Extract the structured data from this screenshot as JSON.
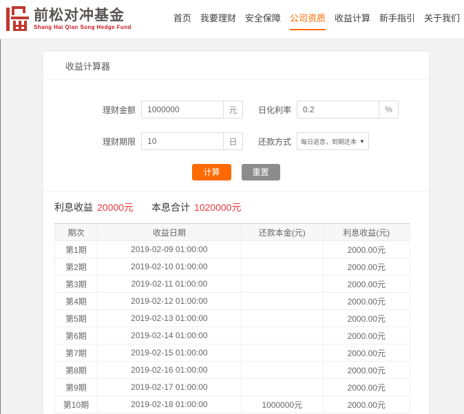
{
  "brand": {
    "title": "前松对冲基金",
    "subtitle": "Shang Hai Qian Song Hedge Fund"
  },
  "nav": {
    "items": [
      {
        "label": "首页",
        "active": false
      },
      {
        "label": "我要理财",
        "active": false
      },
      {
        "label": "安全保障",
        "active": false
      },
      {
        "label": "公司资质",
        "active": true
      },
      {
        "label": "收益计算",
        "active": false
      },
      {
        "label": "新手指引",
        "active": false
      },
      {
        "label": "关于我们",
        "active": false
      }
    ]
  },
  "calculator": {
    "title": "收益计算器",
    "amount_label": "理财金额",
    "amount_value": "1000000",
    "amount_unit": "元",
    "rate_label": "日化利率",
    "rate_value": "0.2",
    "rate_unit": "%",
    "period_label": "理财期限",
    "period_value": "10",
    "period_unit": "日",
    "repay_label": "还款方式",
    "repay_value": "每日返息，到期还本",
    "calc_button": "计算",
    "reset_button": "重置"
  },
  "results": {
    "interest_label": "利息收益",
    "interest_value": "20000元",
    "total_label": "本息合计",
    "total_value": "1020000元"
  },
  "table": {
    "headers": [
      "期次",
      "收益日期",
      "还款本金(元)",
      "利息收益(元)"
    ],
    "rows": [
      [
        "第1期",
        "2019-02-09 01:00:00",
        "",
        "2000.00元"
      ],
      [
        "第2期",
        "2019-02-10 01:00:00",
        "",
        "2000.00元"
      ],
      [
        "第3期",
        "2019-02-11 01:00:00",
        "",
        "2000.00元"
      ],
      [
        "第4期",
        "2019-02-12 01:00:00",
        "",
        "2000.00元"
      ],
      [
        "第5期",
        "2019-02-13 01:00:00",
        "",
        "2000.00元"
      ],
      [
        "第6期",
        "2019-02-14 01:00:00",
        "",
        "2000.00元"
      ],
      [
        "第7期",
        "2019-02-15 01:00:00",
        "",
        "2000.00元"
      ],
      [
        "第8期",
        "2019-02-16 01:00:00",
        "",
        "2000.00元"
      ],
      [
        "第9期",
        "2019-02-17 01:00:00",
        "",
        "2000.00元"
      ],
      [
        "第10期",
        "2019-02-18 01:00:00",
        "1000000元",
        "2000.00元"
      ]
    ]
  },
  "colors": {
    "accent": "#ff6a00",
    "value_red": "#e4393c",
    "seal_red": "#c0392f"
  }
}
